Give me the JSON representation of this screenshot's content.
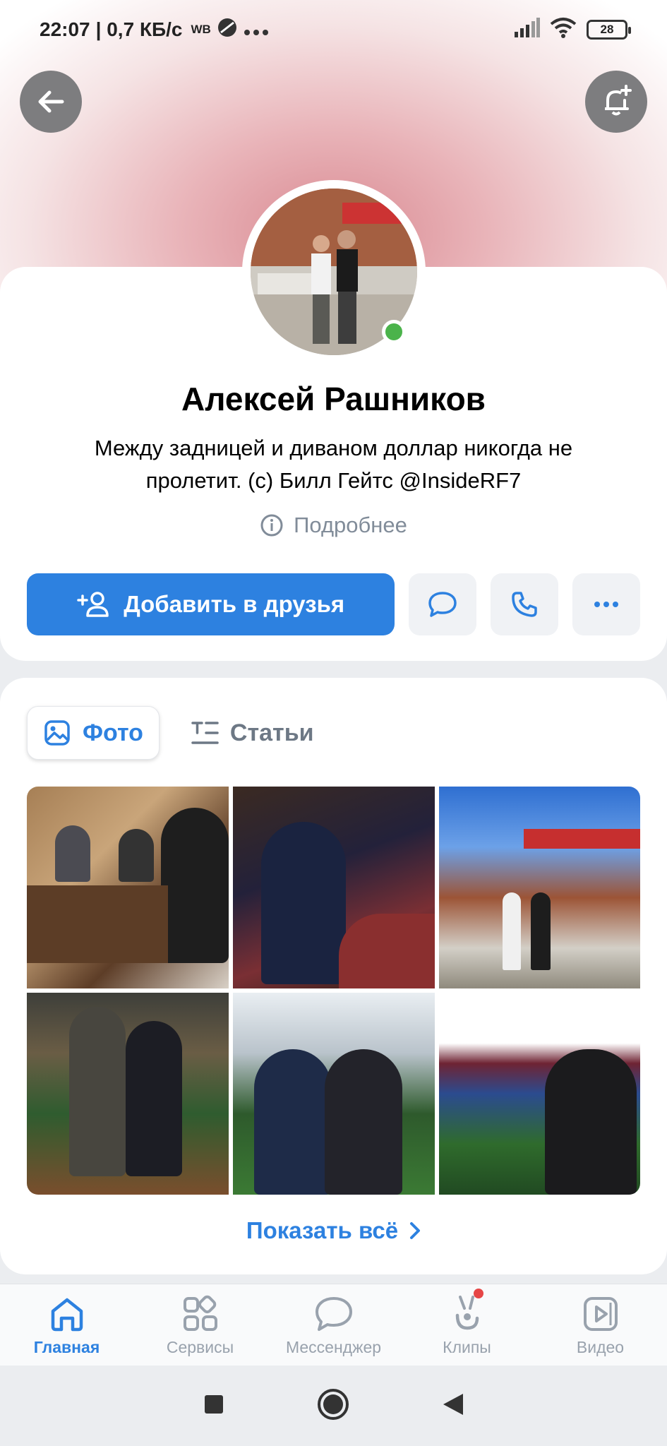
{
  "status_bar": {
    "time": "22:07",
    "speed": "| 0,7 КБ/с",
    "carrier": "WB",
    "battery": "28"
  },
  "profile": {
    "name": "Алексей Рашников",
    "status_line1": "Между задницей и диваном доллар никогда не",
    "status_line2": "пролетит. (с) Билл Гейтс @InsideRF7",
    "more_info": "Подробнее",
    "online": true
  },
  "actions": {
    "add_friend": "Добавить в друзья"
  },
  "media": {
    "tabs": [
      {
        "label": "Фото",
        "icon": "photo-icon",
        "active": true
      },
      {
        "label": "Статьи",
        "icon": "articles-icon",
        "active": false
      }
    ],
    "show_all": "Показать всё"
  },
  "tabbar": {
    "items": [
      {
        "label": "Главная",
        "icon": "home-icon",
        "active": true
      },
      {
        "label": "Сервисы",
        "icon": "services-icon",
        "active": false
      },
      {
        "label": "Мессенджер",
        "icon": "messenger-icon",
        "active": false
      },
      {
        "label": "Клипы",
        "icon": "clips-icon",
        "active": false,
        "badge": true
      },
      {
        "label": "Видео",
        "icon": "video-icon",
        "active": false
      }
    ]
  },
  "colors": {
    "accent": "#2d81e0",
    "online": "#4bb34b",
    "badge": "#e64646"
  }
}
